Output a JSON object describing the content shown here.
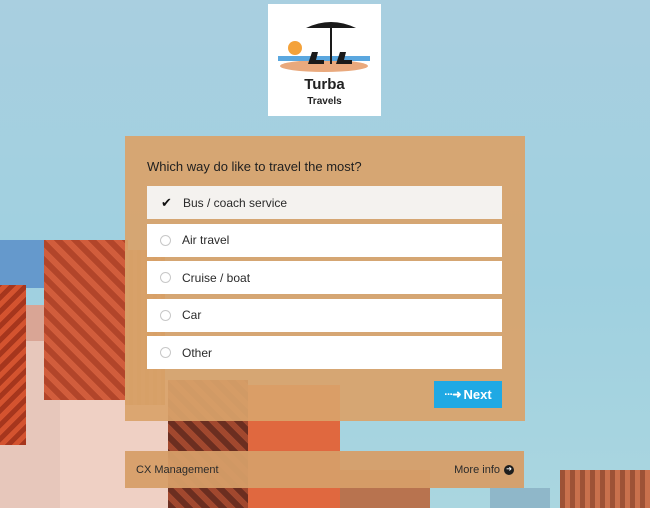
{
  "logo": {
    "title": "Turba",
    "subtitle": "Travels",
    "icons": [
      "sun-icon",
      "umbrella-icon",
      "beach-chairs-icon"
    ]
  },
  "survey": {
    "question": "Which way do like to travel the most?",
    "options": [
      {
        "label": "Bus / coach service",
        "selected": true
      },
      {
        "label": "Air travel",
        "selected": false
      },
      {
        "label": "Cruise / boat",
        "selected": false
      },
      {
        "label": "Car",
        "selected": false
      },
      {
        "label": "Other",
        "selected": false
      }
    ],
    "next_label": "Next",
    "next_icon": "dotted-arrow-right-icon"
  },
  "footer": {
    "brand": "CX Management",
    "more_info": "More info",
    "more_info_icon": "arrow-circle-right-icon"
  },
  "colors": {
    "card_bg": "#d9a36b",
    "button": "#1fa9e4",
    "sky": "#a9cfe0"
  }
}
